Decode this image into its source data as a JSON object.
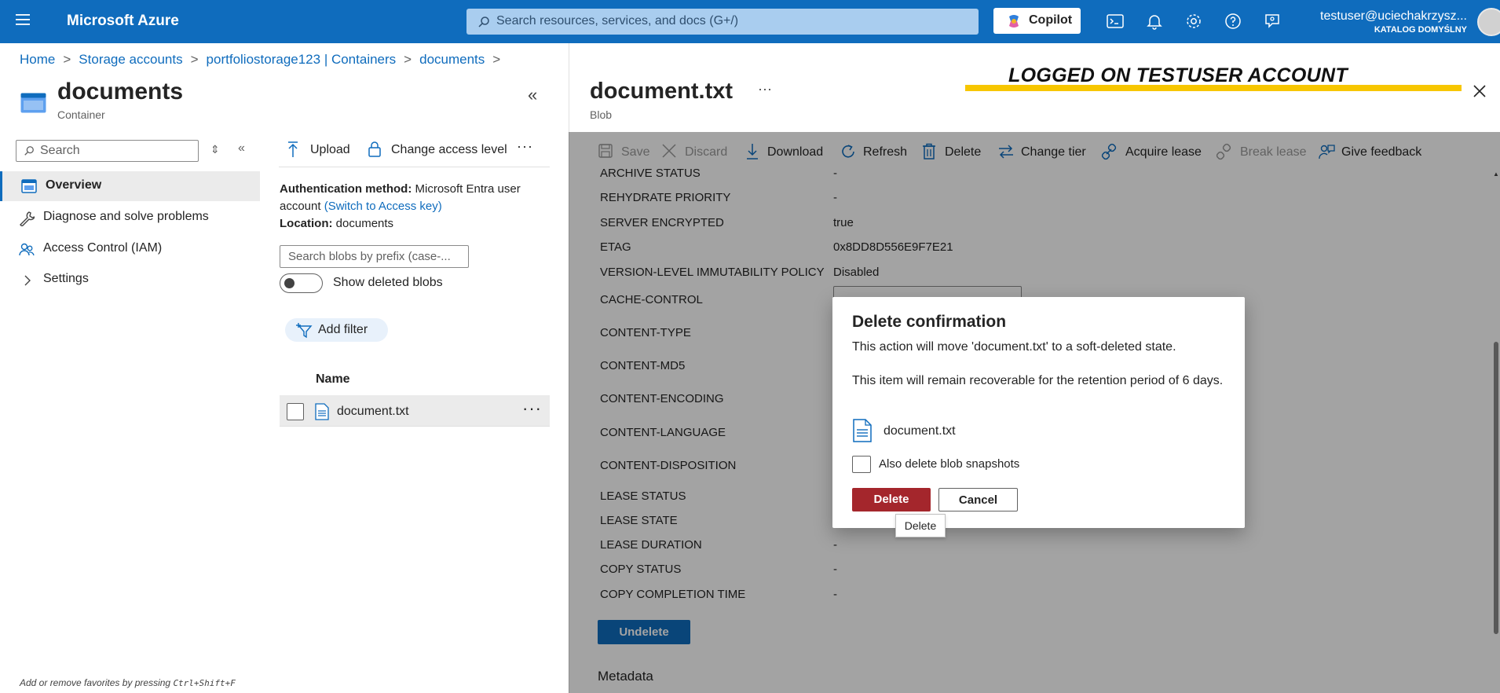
{
  "header": {
    "brand": "Microsoft Azure",
    "search_placeholder": "Search resources, services, and docs (G+/)",
    "copilot_label": "Copilot",
    "user_name": "testuser@uciechakrzysz...",
    "user_directory": "KATALOG DOMYŚLNY"
  },
  "breadcrumb": [
    "Home",
    "Storage accounts",
    "portfoliostorage123 | Containers",
    "documents"
  ],
  "resource": {
    "title": "documents",
    "subtitle": "Container"
  },
  "nav": {
    "search_placeholder": "Search",
    "items": [
      {
        "label": "Overview",
        "icon": "overview-icon",
        "active": true
      },
      {
        "label": "Diagnose and solve problems",
        "icon": "wrench-icon",
        "active": false
      },
      {
        "label": "Access Control (IAM)",
        "icon": "people-icon",
        "active": false
      },
      {
        "label": "Settings",
        "icon": "chevron-right-icon",
        "active": false
      }
    ],
    "favorites_hint": "Add or remove favorites by pressing",
    "favorites_shortcut": "Ctrl+Shift+F"
  },
  "container": {
    "toolbar": {
      "upload": "Upload",
      "change_access": "Change access level",
      "more": "···"
    },
    "auth_label": "Authentication method:",
    "auth_value": "Microsoft Entra user account",
    "auth_link": "(Switch to Access key)",
    "location_label": "Location:",
    "location_value": "documents",
    "search_placeholder": "Search blobs by prefix (case-...",
    "show_deleted_label": "Show deleted blobs",
    "show_deleted_on": false,
    "add_filter": "Add filter",
    "column_name": "Name",
    "blobs": [
      {
        "name": "document.txt"
      }
    ]
  },
  "blob": {
    "title": "document.txt",
    "subtitle": "Blob",
    "banner": "LOGGED ON TESTUSER ACCOUNT",
    "banner_color": "#f7c600",
    "toolbar": {
      "save": "Save",
      "discard": "Discard",
      "download": "Download",
      "refresh": "Refresh",
      "delete": "Delete",
      "change_tier": "Change tier",
      "acquire_lease": "Acquire lease",
      "break_lease": "Break lease",
      "give_feedback": "Give feedback"
    },
    "properties": [
      {
        "label": "ARCHIVE STATUS",
        "value": "-"
      },
      {
        "label": "REHYDRATE PRIORITY",
        "value": "-"
      },
      {
        "label": "SERVER ENCRYPTED",
        "value": "true"
      },
      {
        "label": "ETAG",
        "value": "0x8DD8D556E9F7E21"
      },
      {
        "label": "VERSION-LEVEL IMMUTABILITY POLICY",
        "value": "Disabled"
      },
      {
        "label": "CACHE-CONTROL",
        "value": ""
      },
      {
        "label": "CONTENT-TYPE",
        "value": ""
      },
      {
        "label": "CONTENT-MD5",
        "value": ""
      },
      {
        "label": "CONTENT-ENCODING",
        "value": ""
      },
      {
        "label": "CONTENT-LANGUAGE",
        "value": ""
      },
      {
        "label": "CONTENT-DISPOSITION",
        "value": ""
      },
      {
        "label": "LEASE STATUS",
        "value": ""
      },
      {
        "label": "LEASE STATE",
        "value": ""
      },
      {
        "label": "LEASE DURATION",
        "value": "-"
      },
      {
        "label": "COPY STATUS",
        "value": "-"
      },
      {
        "label": "COPY COMPLETION TIME",
        "value": "-"
      }
    ],
    "undelete": "Undelete",
    "metadata": "Metadata"
  },
  "dialog": {
    "title": "Delete confirmation",
    "message1": "This action will move 'document.txt' to a soft-deleted state.",
    "message2": "This item will remain recoverable for the retention period of 6 days.",
    "file": "document.txt",
    "snapshots_label": "Also delete blob snapshots",
    "snapshots_checked": false,
    "delete": "Delete",
    "cancel": "Cancel",
    "tooltip": "Delete"
  },
  "colors": {
    "accent": "#0f6cbd",
    "danger": "#a4262c"
  }
}
